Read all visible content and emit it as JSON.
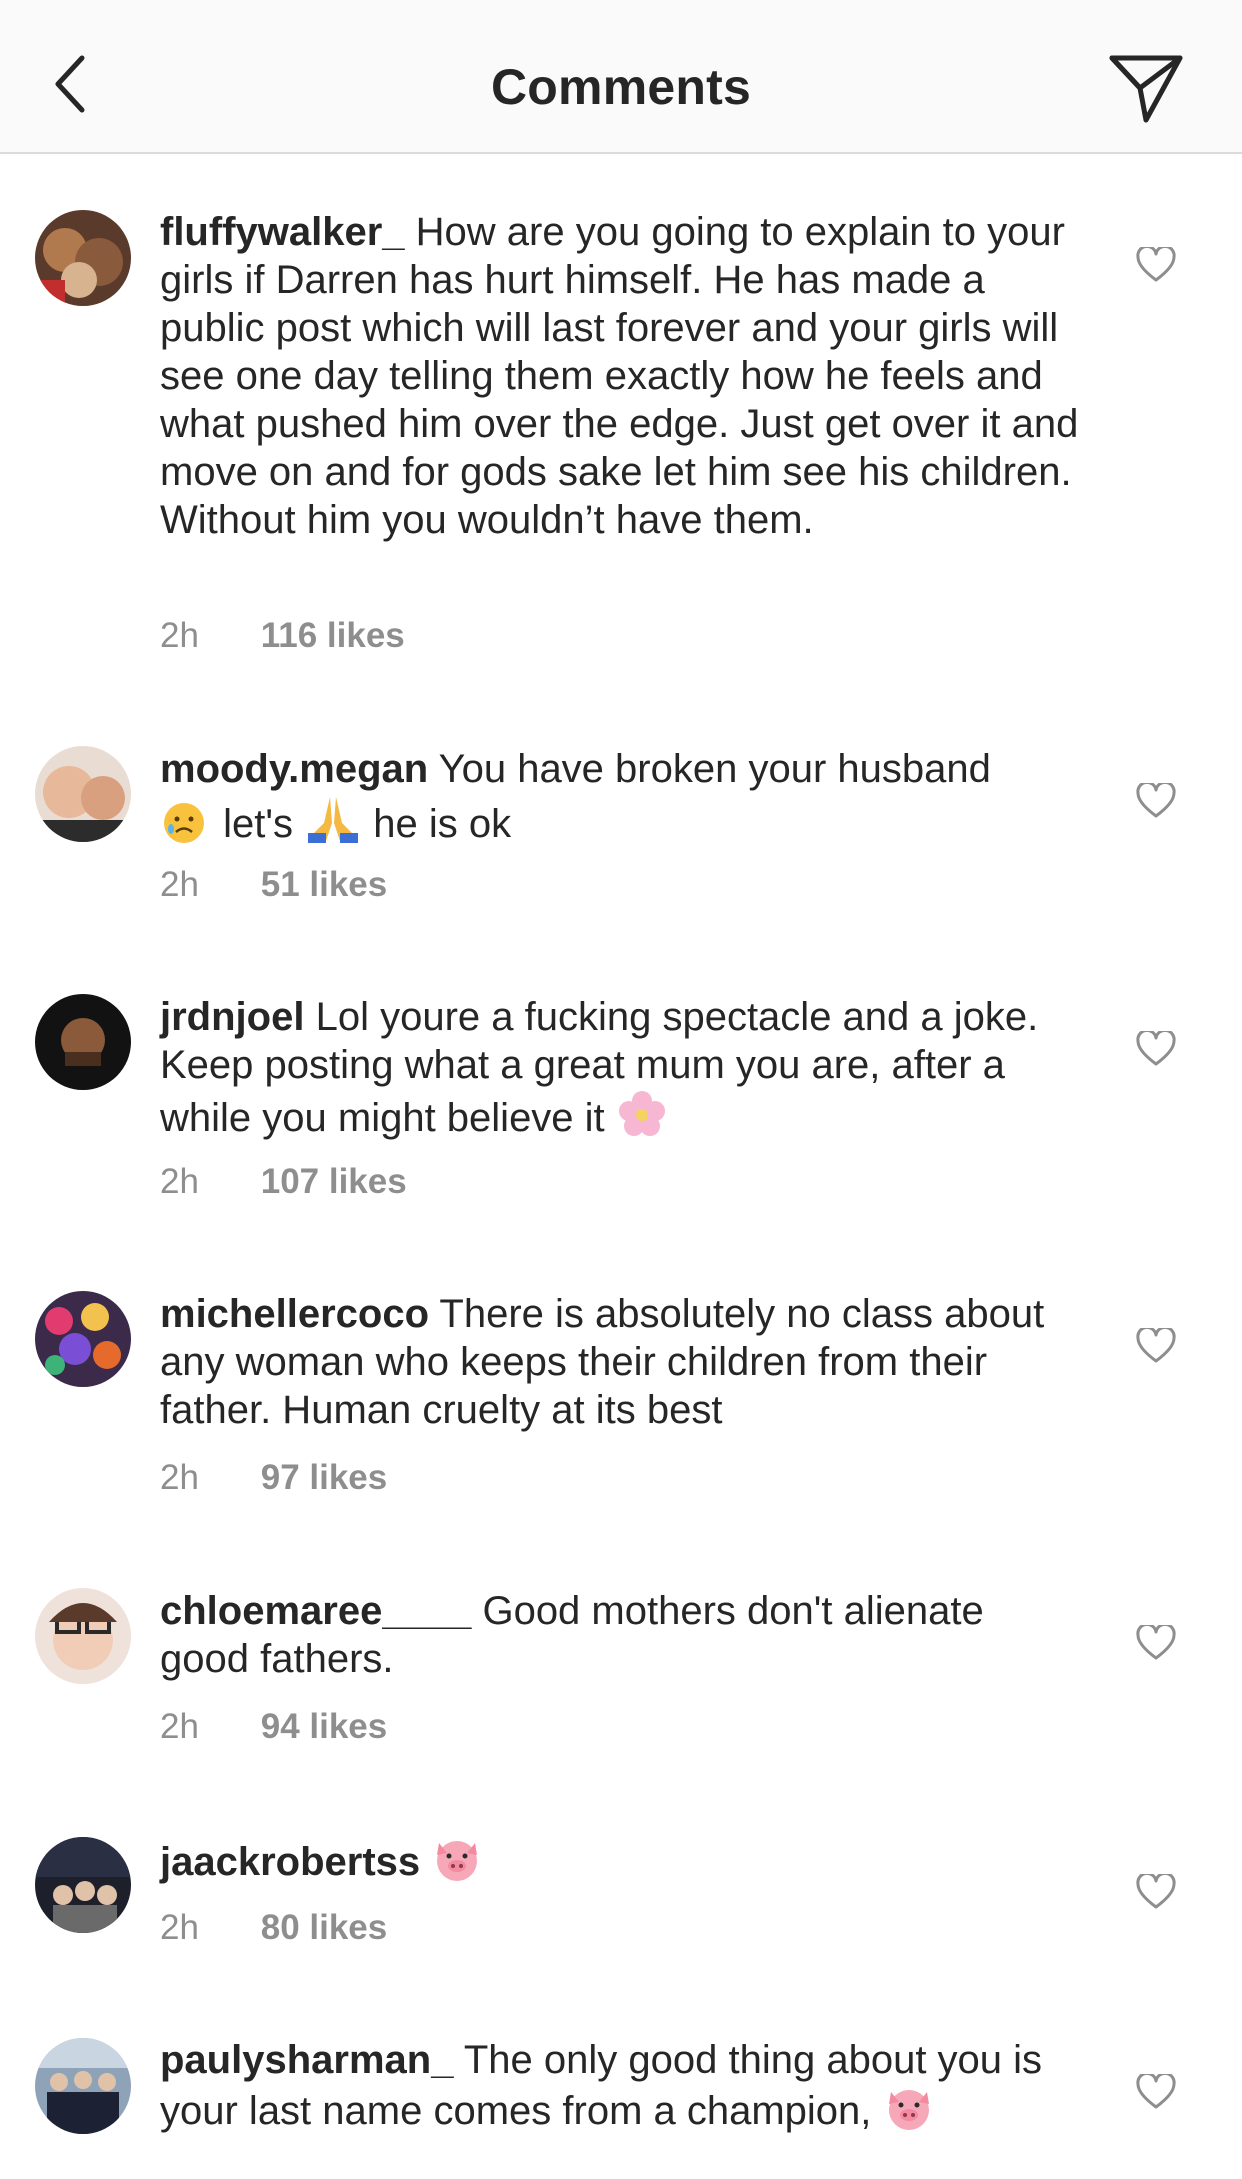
{
  "header": {
    "title": "Comments"
  },
  "comments": [
    {
      "username": "fluffywalker_",
      "text": "How are you going to explain to your girls if Darren has hurt himself. He has made a public post which will last forever and your girls will see one day telling them exactly how he feels and what pushed him over the edge. Just get over it and move on and for gods sake let him see his children. Without him you wouldn’t have them.",
      "time": "2h",
      "likes": "116 likes"
    },
    {
      "username": "moody.megan",
      "text_a": "You have broken your husband",
      "text_b": "let's",
      "text_c": "he is ok",
      "emoji_1": "sad-face-emoji",
      "emoji_2": "praying-hands-emoji",
      "time": "2h",
      "likes": "51 likes"
    },
    {
      "username": "jrdnjoel",
      "text": "Lol youre a fucking spectacle and a joke. Keep posting what a great mum you are, after a while you might believe it",
      "emoji_1": "cherry-blossom-emoji",
      "time": "2h",
      "likes": "107 likes"
    },
    {
      "username": "michellercoco",
      "text": "There is absolutely no class about any woman who keeps their children from their father. Human cruelty at its best",
      "time": "2h",
      "likes": "97 likes"
    },
    {
      "username": "chloemaree____",
      "text": "Good mothers don't alienate good fathers.",
      "time": "2h",
      "likes": "94 likes"
    },
    {
      "username": "jaackrobertss",
      "emoji_1": "pig-face-emoji",
      "time": "2h",
      "likes": "80 likes"
    },
    {
      "username": "paulysharman_",
      "text": "The only good thing about you is your last name comes from a champion,",
      "emoji_1": "pig-face-emoji"
    }
  ]
}
